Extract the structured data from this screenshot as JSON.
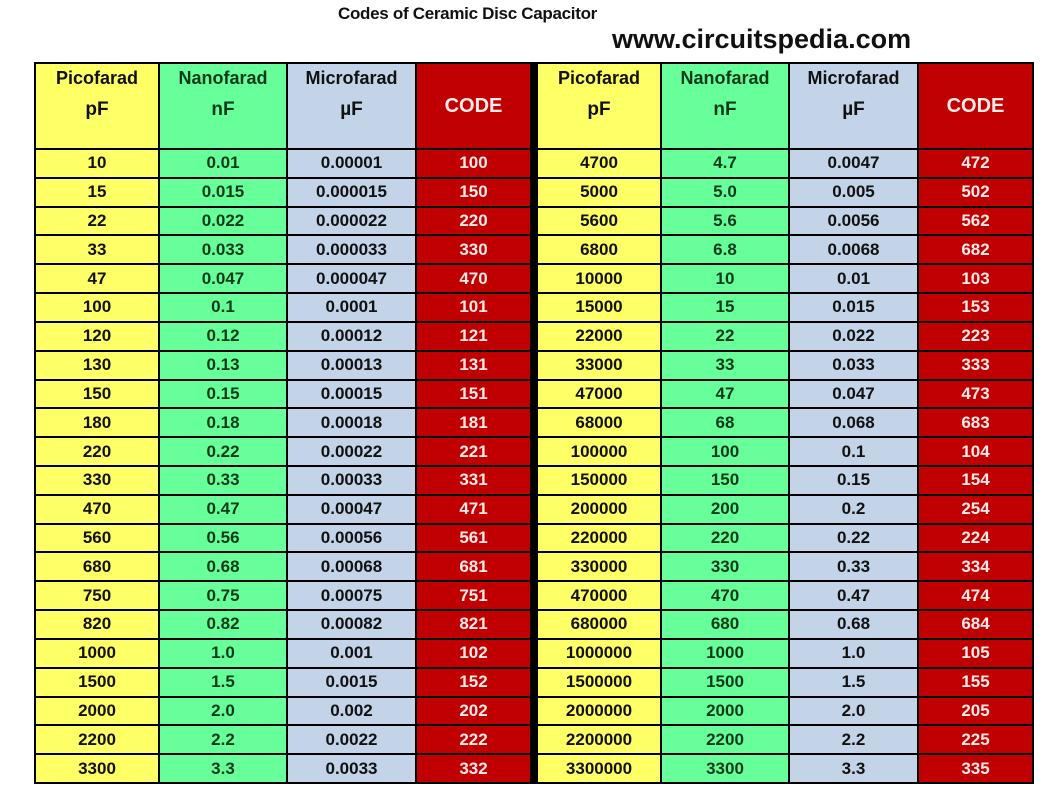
{
  "title": "Codes of Ceramic Disc Capacitor",
  "website": "www.circuitspedia.com",
  "colors": {
    "picofarad": "#ffff66",
    "nanofarad": "#66ff99",
    "microfarad": "#c3d4e8",
    "code": "#c00000"
  },
  "headers": [
    {
      "name": "Picofarad",
      "unit": "pF"
    },
    {
      "name": "Nanofarad",
      "unit": "nF"
    },
    {
      "name": "Microfarad",
      "unit": "µF"
    },
    {
      "name": "CODE",
      "unit": ""
    }
  ],
  "left_table": [
    [
      "10",
      "0.01",
      "0.00001",
      "100"
    ],
    [
      "15",
      "0.015",
      "0.000015",
      "150"
    ],
    [
      "22",
      "0.022",
      "0.000022",
      "220"
    ],
    [
      "33",
      "0.033",
      "0.000033",
      "330"
    ],
    [
      "47",
      "0.047",
      "0.000047",
      "470"
    ],
    [
      "100",
      "0.1",
      "0.0001",
      "101"
    ],
    [
      "120",
      "0.12",
      "0.00012",
      "121"
    ],
    [
      "130",
      "0.13",
      "0.00013",
      "131"
    ],
    [
      "150",
      "0.15",
      "0.00015",
      "151"
    ],
    [
      "180",
      "0.18",
      "0.00018",
      "181"
    ],
    [
      "220",
      "0.22",
      "0.00022",
      "221"
    ],
    [
      "330",
      "0.33",
      "0.00033",
      "331"
    ],
    [
      "470",
      "0.47",
      "0.00047",
      "471"
    ],
    [
      "560",
      "0.56",
      "0.00056",
      "561"
    ],
    [
      "680",
      "0.68",
      "0.00068",
      "681"
    ],
    [
      "750",
      "0.75",
      "0.00075",
      "751"
    ],
    [
      "820",
      "0.82",
      "0.00082",
      "821"
    ],
    [
      "1000",
      "1.0",
      "0.001",
      "102"
    ],
    [
      "1500",
      "1.5",
      "0.0015",
      "152"
    ],
    [
      "2000",
      "2.0",
      "0.002",
      "202"
    ],
    [
      "2200",
      "2.2",
      "0.0022",
      "222"
    ],
    [
      "3300",
      "3.3",
      "0.0033",
      "332"
    ]
  ],
  "right_table": [
    [
      "4700",
      "4.7",
      "0.0047",
      "472"
    ],
    [
      "5000",
      "5.0",
      "0.005",
      "502"
    ],
    [
      "5600",
      "5.6",
      "0.0056",
      "562"
    ],
    [
      "6800",
      "6.8",
      "0.0068",
      "682"
    ],
    [
      "10000",
      "10",
      "0.01",
      "103"
    ],
    [
      "15000",
      "15",
      "0.015",
      "153"
    ],
    [
      "22000",
      "22",
      "0.022",
      "223"
    ],
    [
      "33000",
      "33",
      "0.033",
      "333"
    ],
    [
      "47000",
      "47",
      "0.047",
      "473"
    ],
    [
      "68000",
      "68",
      "0.068",
      "683"
    ],
    [
      "100000",
      "100",
      "0.1",
      "104"
    ],
    [
      "150000",
      "150",
      "0.15",
      "154"
    ],
    [
      "200000",
      "200",
      "0.2",
      "254"
    ],
    [
      "220000",
      "220",
      "0.22",
      "224"
    ],
    [
      "330000",
      "330",
      "0.33",
      "334"
    ],
    [
      "470000",
      "470",
      "0.47",
      "474"
    ],
    [
      "680000",
      "680",
      "0.68",
      "684"
    ],
    [
      "1000000",
      "1000",
      "1.0",
      "105"
    ],
    [
      "1500000",
      "1500",
      "1.5",
      "155"
    ],
    [
      "2000000",
      "2000",
      "2.0",
      "205"
    ],
    [
      "2200000",
      "2200",
      "2.2",
      "225"
    ],
    [
      "3300000",
      "3300",
      "3.3",
      "335"
    ]
  ]
}
